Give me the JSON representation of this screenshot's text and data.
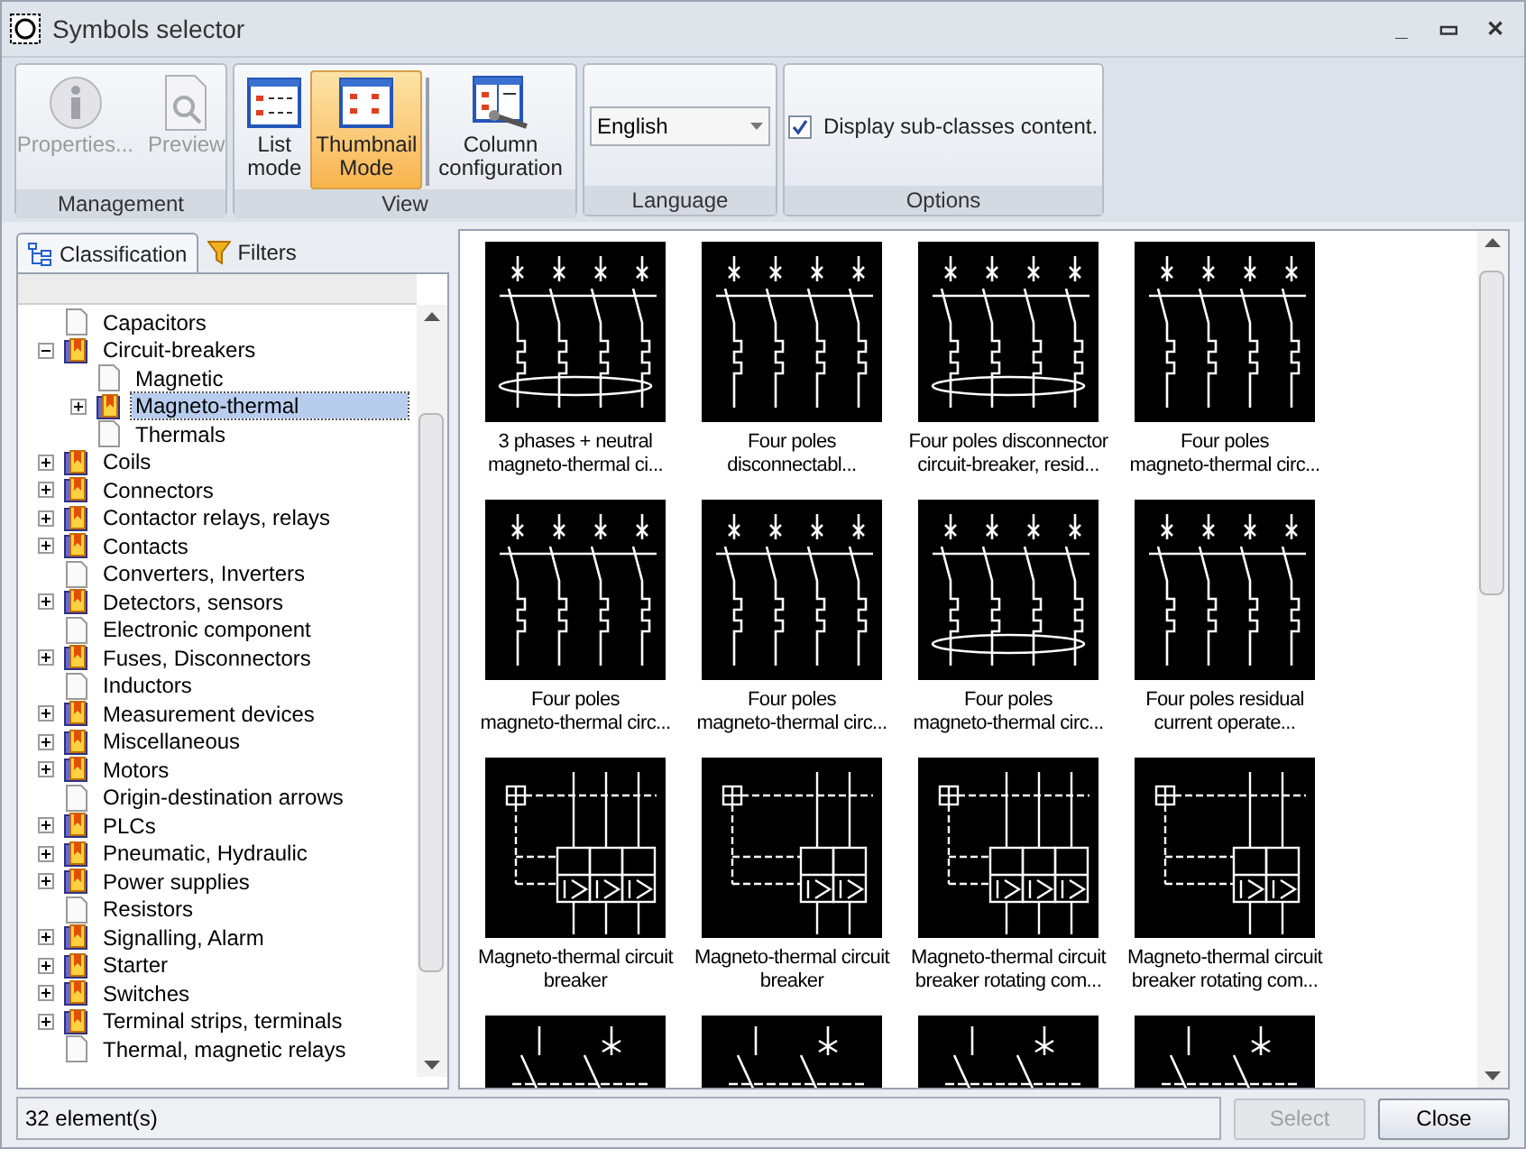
{
  "window": {
    "title": "Symbols selector",
    "controls": [
      "_",
      "▭",
      "✕"
    ]
  },
  "ribbon": {
    "groups": [
      {
        "label": "Management",
        "items": [
          {
            "kind": "button",
            "label": "Properties...",
            "disabled": true,
            "selected": false
          },
          {
            "kind": "button",
            "label": "Preview",
            "disabled": true,
            "selected": false
          }
        ]
      },
      {
        "label": "View",
        "items": [
          {
            "kind": "button",
            "label": "List\nmode",
            "disabled": false,
            "selected": false
          },
          {
            "kind": "button",
            "label": "Thumbnail\nMode",
            "disabled": false,
            "selected": true
          },
          {
            "kind": "separator"
          },
          {
            "kind": "button",
            "label": "Column\nconfiguration",
            "disabled": false,
            "selected": false
          }
        ]
      },
      {
        "label": "Language",
        "items": [
          {
            "kind": "dropdown",
            "value": "English"
          }
        ]
      },
      {
        "label": "Options",
        "items": [
          {
            "kind": "checkbox",
            "label": "Display sub-classes content.",
            "checked": true
          }
        ]
      }
    ]
  },
  "left_tabs": [
    {
      "label": "Classification",
      "selected": true
    },
    {
      "label": "Filters",
      "selected": false
    }
  ],
  "tree": [
    {
      "label": "Capacitors",
      "kind": "leaf"
    },
    {
      "label": "Circuit-breakers",
      "kind": "folder",
      "expanded": true,
      "children": [
        {
          "label": "Magnetic",
          "kind": "leaf"
        },
        {
          "label": "Magneto-thermal",
          "kind": "folder",
          "expanded": false,
          "selected": true
        },
        {
          "label": "Thermals",
          "kind": "leaf"
        }
      ]
    },
    {
      "label": "Coils",
      "kind": "folder",
      "expanded": false
    },
    {
      "label": "Connectors",
      "kind": "folder",
      "expanded": false
    },
    {
      "label": "Contactor relays, relays",
      "kind": "folder",
      "expanded": false
    },
    {
      "label": "Contacts",
      "kind": "folder",
      "expanded": false
    },
    {
      "label": "Converters, Inverters",
      "kind": "leaf"
    },
    {
      "label": "Detectors, sensors",
      "kind": "folder",
      "expanded": false
    },
    {
      "label": "Electronic component",
      "kind": "leaf"
    },
    {
      "label": "Fuses, Disconnectors",
      "kind": "folder",
      "expanded": false
    },
    {
      "label": "Inductors",
      "kind": "leaf"
    },
    {
      "label": "Measurement devices",
      "kind": "folder",
      "expanded": false
    },
    {
      "label": "Miscellaneous",
      "kind": "folder",
      "expanded": false
    },
    {
      "label": "Motors",
      "kind": "folder",
      "expanded": false
    },
    {
      "label": "Origin-destination arrows",
      "kind": "leaf"
    },
    {
      "label": "PLCs",
      "kind": "folder",
      "expanded": false
    },
    {
      "label": "Pneumatic, Hydraulic",
      "kind": "folder",
      "expanded": false
    },
    {
      "label": "Power supplies",
      "kind": "folder",
      "expanded": false
    },
    {
      "label": "Resistors",
      "kind": "leaf"
    },
    {
      "label": "Signalling, Alarm",
      "kind": "folder",
      "expanded": false
    },
    {
      "label": "Starter",
      "kind": "folder",
      "expanded": false
    },
    {
      "label": "Switches",
      "kind": "folder",
      "expanded": false
    },
    {
      "label": "Terminal strips, terminals",
      "kind": "folder",
      "expanded": false
    },
    {
      "label": "Thermal, magnetic relays",
      "kind": "leaf"
    }
  ],
  "thumbnails": [
    {
      "label": "3 phases + neutral\nmagneto-thermal ci..."
    },
    {
      "label": "Four poles\ndisconnectabl..."
    },
    {
      "label": "Four poles disconnector\ncircuit-breaker, resid..."
    },
    {
      "label": "Four poles\nmagneto-thermal circ..."
    },
    {
      "label": "Four poles\nmagneto-thermal circ..."
    },
    {
      "label": "Four poles\nmagneto-thermal circ..."
    },
    {
      "label": "Four poles\nmagneto-thermal circ..."
    },
    {
      "label": "Four poles residual\ncurrent operate..."
    },
    {
      "label": "Magneto-thermal circuit\nbreaker"
    },
    {
      "label": "Magneto-thermal circuit\nbreaker"
    },
    {
      "label": "Magneto-thermal circuit\nbreaker rotating com..."
    },
    {
      "label": "Magneto-thermal circuit\nbreaker rotating com..."
    }
  ],
  "status_bar": {
    "count": "32 element(s)"
  },
  "buttons": [
    {
      "label": "Select",
      "disabled": true
    },
    {
      "label": "Close",
      "disabled": false
    }
  ]
}
